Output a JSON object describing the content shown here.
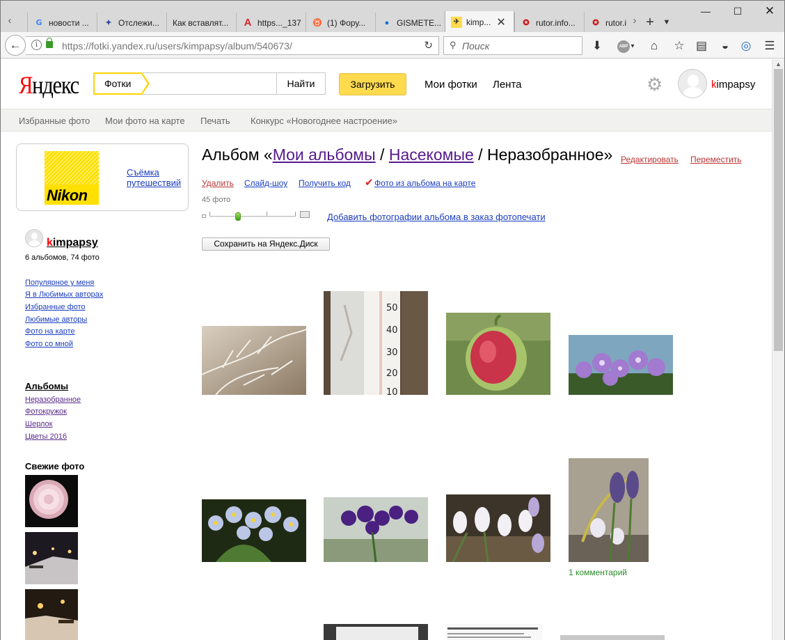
{
  "browser": {
    "tabs": [
      {
        "label": "новости ...",
        "icon": "google-icon"
      },
      {
        "label": "Отслежи...",
        "icon": "eagle-emblem-icon"
      },
      {
        "label": "Как вставлят...",
        "icon": "blank-page-icon"
      },
      {
        "label": "https..._137",
        "icon": "letter-a-icon"
      },
      {
        "label": "(1) Фору...",
        "icon": "bull-icon"
      },
      {
        "label": "GISMETE...",
        "icon": "water-drop-icon"
      },
      {
        "label": "kimp...",
        "icon": "yandex-fotki-icon",
        "active": true
      },
      {
        "label": "rutor.info...",
        "icon": "star-badge-icon"
      },
      {
        "label": "rutor.i",
        "icon": "star-badge-icon"
      }
    ],
    "url_host": "https://fotki.yandex.ru",
    "url_path": "/users/kimpapsy/album/540673/",
    "search_placeholder": "Поиск",
    "adblock_label": "ABP"
  },
  "header": {
    "logo_first": "Я",
    "logo_rest": "ндекс",
    "search_tag": "Фотки",
    "search_value": "",
    "search_button": "Найти",
    "upload_button": "Загрузить",
    "nav": [
      "Мои фотки",
      "Лента"
    ],
    "user_first": "k",
    "user_rest": "impapsy"
  },
  "subnav": [
    "Избранные фото",
    "Мои фото на карте",
    "Печать",
    "Конкурс «Новогоднее настроение»"
  ],
  "ad": {
    "brand": "Nikon",
    "link": "Съёмка путешествий"
  },
  "sidebar": {
    "user_first": "k",
    "user_rest": "impapsy",
    "stats": "6 альбомов, 74 фото",
    "links": [
      "Популярное у меня",
      "Я в Любимых авторах",
      "Избранные фото",
      "Любимые авторы",
      "Фото на карте",
      "Фото со мной"
    ],
    "albums_heading": "Альбомы",
    "albums": [
      "Неразобранное",
      "Фотокружок",
      "Шерлок",
      "Цветы 2016"
    ],
    "fresh_heading": "Свежие фото"
  },
  "album": {
    "title_prefix": "Альбом «",
    "crumb1": "Мои альбомы",
    "sep": " / ",
    "crumb2": "Насекомые",
    "current": "Неразобранное»",
    "edit": "Редактировать",
    "move": "Переместить",
    "actions": [
      "Удалить",
      "Слайд-шоу",
      "Получить код",
      "Фото из альбома на карте"
    ],
    "count": "45 фото",
    "order_link": "Добавить фотографии альбома в заказ фотопечати",
    "disk_button": "Сохранить на Яндекс.Диск",
    "comment": "1 комментарий"
  },
  "colors": {
    "accent": "#ffdb4d",
    "logo_red": "#ff0000",
    "link": "#1a3dc1",
    "visited": "#551a8b"
  }
}
